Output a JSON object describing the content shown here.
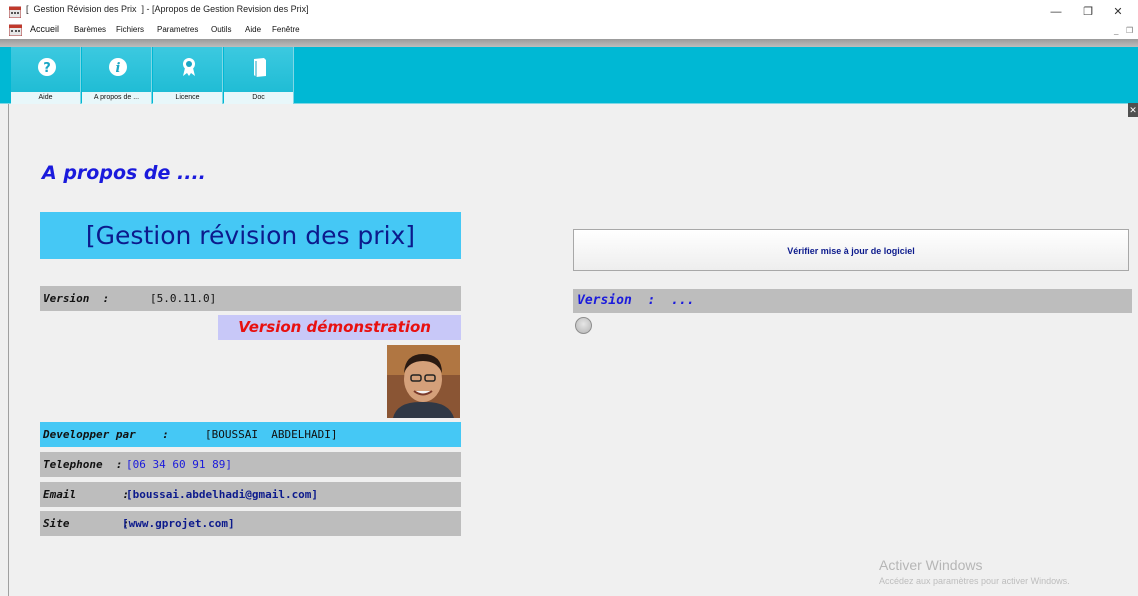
{
  "window": {
    "title": "[  Gestion Révision des Prix  ] - [Apropos de Gestion Revision des Prix]",
    "minimize_glyph": "—",
    "maximize_glyph": "❐",
    "close_glyph": "✕",
    "mdi_min": "_",
    "mdi_restore": "❒"
  },
  "menu": {
    "items": [
      "Accueil",
      "Barèmes",
      "Fichiers",
      "Parametres",
      "Outils",
      "Aide",
      "Fenêtre"
    ]
  },
  "ribbon": {
    "color": "#00b8d4",
    "buttons": [
      {
        "label": "Aide",
        "icon": "help-icon"
      },
      {
        "label": "A propos de ...",
        "icon": "info-icon"
      },
      {
        "label": "Licence",
        "icon": "award-ribbon-icon"
      },
      {
        "label": "Doc",
        "icon": "book-icon"
      }
    ]
  },
  "about": {
    "heading": "A propos de ....",
    "app_name": "[Gestion révision des prix]",
    "version_label": "Version  :",
    "version_value": "[5.0.11.0]",
    "demo_text": "Version démonstration",
    "developer_label": "Developper par    :",
    "developer_value": "[BOUSSAI  ABDELHADI]",
    "phone_label": "Telephone  :",
    "phone_value": "[06 34 60 91 89]",
    "email_label": "Email       :",
    "email_value": "[boussai.abdelhadi@gmail.com]",
    "site_label": "Site        :",
    "site_value": "[www.gprojet.com]"
  },
  "update": {
    "button_label": "Vérifier mise à jour de logiciel",
    "version_text": "Version  :  ..."
  },
  "watermark": {
    "line1": "Activer Windows",
    "line2": "Accédez aux paramètres pour activer Windows."
  },
  "colors": {
    "title_blue": "#0c1a8c",
    "heading_blue": "#1a1adc",
    "demo_red": "#e81010",
    "app_box": "#45c8f5",
    "row_gray": "#bdbdbd"
  }
}
